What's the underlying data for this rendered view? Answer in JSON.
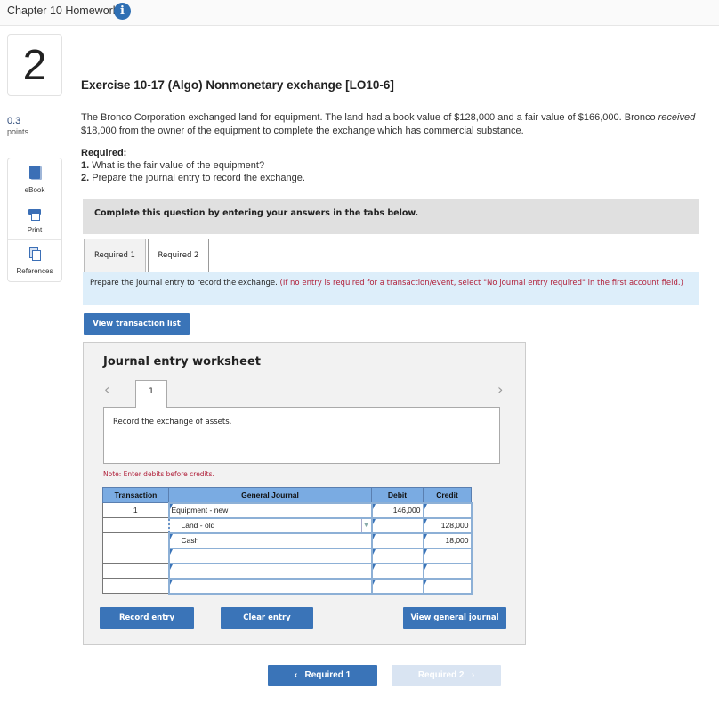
{
  "header": {
    "title": "Chapter 10 Homework",
    "info_icon": "info-icon"
  },
  "sidebar": {
    "question_number": "2",
    "points_value": "0.3",
    "points_label": "points",
    "tools": [
      {
        "label": "eBook",
        "icon": "book-icon"
      },
      {
        "label": "Print",
        "icon": "printer-icon"
      },
      {
        "label": "References",
        "icon": "references-icon"
      }
    ]
  },
  "exercise": {
    "title": "Exercise 10-17 (Algo) Nonmonetary exchange [LO10-6]",
    "problem_part1": "The Bronco Corporation exchanged land for equipment. The land had a book value of $128,000 and a fair value of $166,000. Bronco ",
    "problem_italic": "received",
    "problem_part2": " $18,000 from the owner of the equipment to complete the exchange which has commercial substance.",
    "required_heading": "Required:",
    "required_items": [
      {
        "num": "1.",
        "text": " What is the fair value of the equipment?"
      },
      {
        "num": "2.",
        "text": " Prepare the journal entry to record the exchange."
      }
    ]
  },
  "complete_banner": "Complete this question by entering your answers in the tabs below.",
  "tabs": [
    {
      "label": "Required 1",
      "active": false
    },
    {
      "label": "Required 2",
      "active": true
    }
  ],
  "instructions": {
    "text": "Prepare the journal entry to record the exchange. ",
    "red_text": "(If no entry is required for a transaction/event, select \"No journal entry required\" in the first account field.)"
  },
  "view_transaction_list": "View transaction list",
  "worksheet": {
    "title": "Journal entry worksheet",
    "prev_icon": "‹",
    "next_icon": "›",
    "active_entry": "1",
    "description": "Record the exchange of assets.",
    "note": "Note: Enter debits before credits.",
    "columns": [
      "Transaction",
      "General Journal",
      "Debit",
      "Credit"
    ],
    "rows": [
      {
        "transaction": "1",
        "account": "Equipment - new",
        "debit": "146,000",
        "credit": ""
      },
      {
        "transaction": "",
        "account": "Land - old",
        "debit": "",
        "credit": "128,000"
      },
      {
        "transaction": "",
        "account": "Cash",
        "debit": "",
        "credit": "18,000"
      },
      {
        "transaction": "",
        "account": "",
        "debit": "",
        "credit": ""
      },
      {
        "transaction": "",
        "account": "",
        "debit": "",
        "credit": ""
      },
      {
        "transaction": "",
        "account": "",
        "debit": "",
        "credit": ""
      }
    ],
    "record_entry": "Record entry",
    "clear_entry": "Clear entry",
    "view_general_journal": "View general journal"
  },
  "nav": {
    "prev_label": "Required 1",
    "next_label": "Required 2",
    "prev_icon": "‹",
    "next_icon": "›"
  },
  "colors": {
    "accent_blue": "#3a74b8",
    "header_blue": "#7aabe2",
    "note_red": "#b0203a",
    "instruction_bg": "#ddeefa"
  }
}
